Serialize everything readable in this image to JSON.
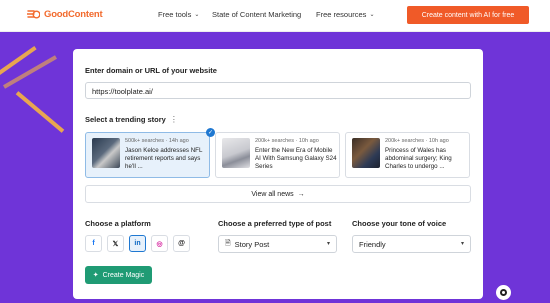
{
  "brand": {
    "name": "GoodContent",
    "color": "#f26a2d"
  },
  "nav": {
    "items": [
      {
        "label": "Free tools",
        "has_caret": true
      },
      {
        "label": "State of Content Marketing",
        "has_caret": false
      },
      {
        "label": "Free resources",
        "has_caret": true
      }
    ],
    "cta_label": "Create content with AI for free"
  },
  "form": {
    "domain_label": "Enter domain or URL of your website",
    "domain_value": "https://toolplate.ai/",
    "trending_label": "Select a trending story",
    "stories": [
      {
        "meta": "500k+ searches · 14h ago",
        "title": "Jason Kelce addresses NFL retirement reports and says he'll ...",
        "selected": true
      },
      {
        "meta": "200k+ searches · 10h ago",
        "title": "Enter the New Era of Mobile AI With Samsung Galaxy S24 Series",
        "selected": false
      },
      {
        "meta": "200k+ searches · 10h ago",
        "title": "Princess of Wales has abdominal surgery; King Charles to undergo ...",
        "selected": false
      }
    ],
    "view_all_label": "View all news",
    "platform_label": "Choose a platform",
    "platforms": [
      "facebook-icon",
      "x-icon",
      "linkedin-icon",
      "instagram-icon",
      "threads-icon"
    ],
    "selected_platform": "linkedin",
    "post_type_label": "Choose a preferred type of post",
    "post_type_value": "Story Post",
    "tone_label": "Choose your tone of voice",
    "tone_value": "Friendly",
    "create_label": "Create Magic"
  },
  "colors": {
    "background": "#6f34d8",
    "accent": "#f05a28",
    "primary_green": "#1f9b74",
    "selected_blue": "#1f78d1"
  }
}
